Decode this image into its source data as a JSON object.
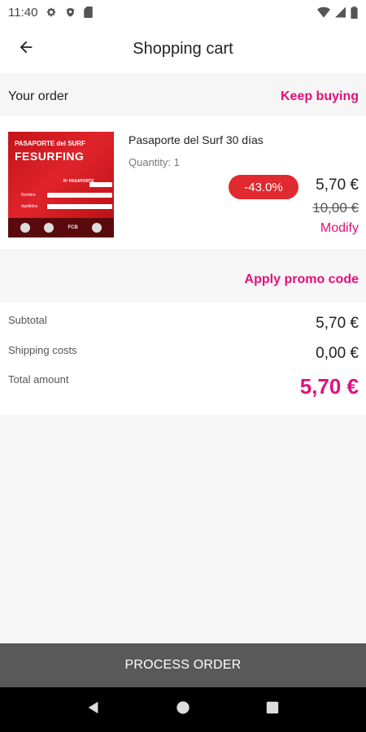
{
  "status_bar": {
    "time": "11:40",
    "icons": [
      "gear-icon",
      "shield-icon",
      "sd-card-icon",
      "wifi-icon",
      "signal-icon",
      "battery-icon"
    ]
  },
  "app_bar": {
    "title": "Shopping cart",
    "back_icon": "arrow-left-icon"
  },
  "order": {
    "title": "Your order",
    "keep_buying_label": "Keep buying"
  },
  "product": {
    "name": "Pasaporte del Surf 30 días",
    "quantity": "Quantity: 1",
    "discount": "-43.0%",
    "price": "5,70 €",
    "old_price": "10,00 €",
    "modify_label": "Modify",
    "thumbnail": {
      "line1": "PASAPORTE del SURF",
      "line2": "FESURFING",
      "line4": "Nº PASAPORTE",
      "field1": "Nombre",
      "field2": "Apellidos",
      "logo_text_1": "FCB"
    }
  },
  "promo": {
    "label": "Apply promo code"
  },
  "totals": {
    "subtotal_label": "Subtotal",
    "subtotal_value": "5,70 €",
    "shipping_label": "Shipping costs",
    "shipping_value": "0,00 €",
    "total_label": "Total amount",
    "total_value": "5,70 €"
  },
  "actions": {
    "process_label": "PROCESS ORDER"
  },
  "nav": {
    "icons": [
      "back-triangle-icon",
      "home-circle-icon",
      "recents-square-icon"
    ]
  },
  "colors": {
    "accent": "#e2107c",
    "badge": "#e02a2f",
    "button": "#595959"
  }
}
